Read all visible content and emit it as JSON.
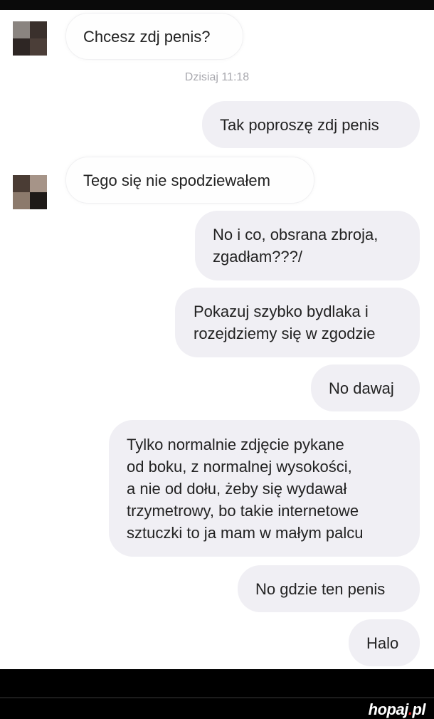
{
  "chat": {
    "timestamp": "Dzisiaj 11:18",
    "messages": [
      {
        "sender": "other",
        "lines": [
          "Chcesz zdj penis?"
        ]
      },
      {
        "sender": "me",
        "lines": [
          "Tak poproszę zdj penis"
        ]
      },
      {
        "sender": "other",
        "lines": [
          "Tego się nie spodziewałem"
        ]
      },
      {
        "sender": "me",
        "lines": [
          "No i co, obsrana zbroja,",
          "zgadłam???/"
        ]
      },
      {
        "sender": "me",
        "lines": [
          "Pokazuj szybko bydlaka i",
          "rozejdziemy się w zgodzie"
        ]
      },
      {
        "sender": "me",
        "lines": [
          "No dawaj"
        ]
      },
      {
        "sender": "me",
        "lines": [
          "Tylko normalnie zdjęcie pykane",
          "od boku, z normalnej wysokości,",
          "a nie od dołu, żeby się wydawał",
          "trzymetrowy, bo takie internetowe",
          "sztuczki to ja mam w małym palcu"
        ]
      },
      {
        "sender": "me",
        "lines": [
          "No gdzie ten penis"
        ]
      },
      {
        "sender": "me",
        "lines": [
          "Halo"
        ]
      }
    ]
  },
  "watermark": {
    "name": "hopaj",
    "dot": ".",
    "tld": "pl",
    "dot_color": "#e42828"
  },
  "colors": {
    "outgoing_bubble": "#f0eff4",
    "incoming_bubble": "#fefefe",
    "timestamp": "#a8a8ae"
  }
}
